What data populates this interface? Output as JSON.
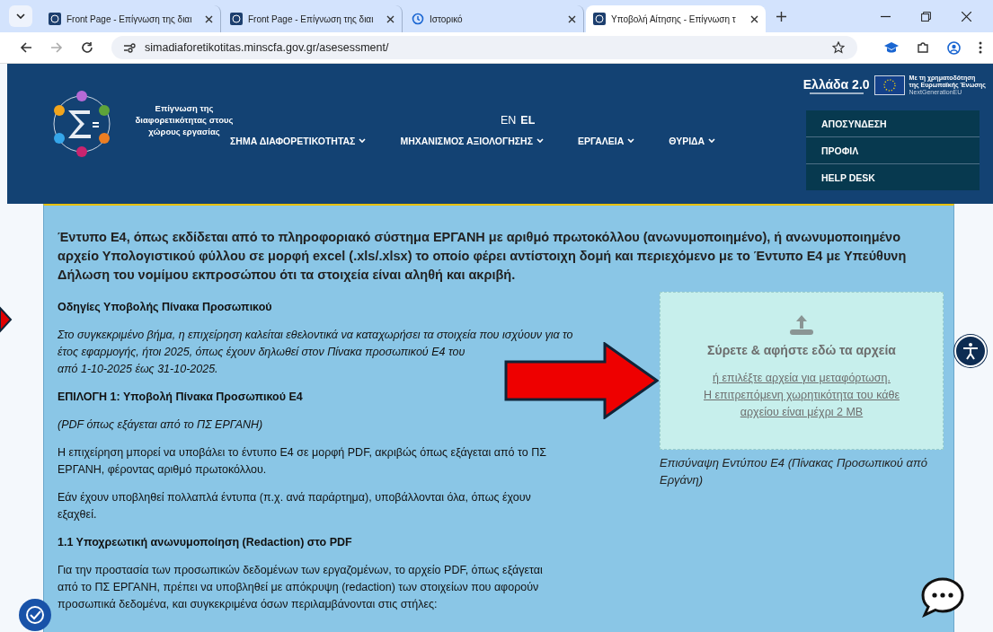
{
  "browser": {
    "tabs": [
      {
        "title": "Front Page - Επίγνωση της διαι",
        "kind": "page",
        "selected": false
      },
      {
        "title": "Front Page - Επίγνωση της διαι",
        "kind": "page",
        "selected": false
      },
      {
        "title": "Ιστορικό",
        "kind": "history",
        "selected": false
      },
      {
        "title": "Υποβολή Αίτησης - Επίγνωση τ",
        "kind": "page",
        "selected": true
      }
    ],
    "url": "simadiaforetikotitas.minscfa.gov.gr/asesessment/"
  },
  "header": {
    "logo_text": "Επίγνωση της διαφορετικότητας στους χώρους εργασίας",
    "languages": [
      {
        "label": "EN",
        "selected": false
      },
      {
        "label": "EL",
        "selected": true
      }
    ],
    "nav": [
      {
        "label": "ΣΗΜΑ ΔΙΑΦΟΡΕΤΙΚΟΤΗΤΑΣ"
      },
      {
        "label": "ΜΗΧΑΝΙΣΜΟΣ ΑΞΙΟΛΟΓΗΣΗΣ"
      },
      {
        "label": "ΕΡΓΑΛΕΙΑ"
      },
      {
        "label": "ΘΥΡΙΔΑ"
      }
    ],
    "greece_logo": "Ελλάδα 2.0",
    "eu_text": [
      "Με τη χρηματοδότηση",
      "της Ευρωπαϊκής Ένωσης",
      "NextGenerationEU"
    ],
    "account_menu": [
      "ΑΠΟΣΥΝΔΕΣΗ",
      "ΠΡΟΦΙΛ",
      "HELP DESK"
    ]
  },
  "content": {
    "intro": "Έντυπο Ε4, όπως εκδίδεται από το πληροφοριακό σύστημα ΕΡΓΑΝΗ με αριθμό πρωτοκόλλου (ανωνυμοποιημένο), ή ανωνυμοποιημένο αρχείο Υπολογιστικού φύλλου σε μορφή excel (.xls/.xlsx)  το οποίο φέρει αντίστοιχη δομή και περιεχόμενο με το Έντυπο Ε4 με Υπεύθυνη Δήλωση του νομίμου εκπροσώπου ότι τα στοιχεία είναι αληθή και ακριβή.",
    "blocks": [
      {
        "kind": "heading",
        "lines": [
          "Οδηγίες Υποβολής Πίνακα Προσωπικού"
        ]
      },
      {
        "kind": "italic",
        "lines": [
          "Στο συγκεκριμένο βήμα, η επιχείρηση καλείται εθελοντικά να καταχωρήσει τα στοιχεία που ισχύουν για το",
          "έτος εφαρμογής, ήτοι 2025, όπως έχουν δηλωθεί στον Πίνακα προσωπικού Ε4 του",
          "από 1-10-2025 έως 31-10-2025."
        ]
      },
      {
        "kind": "heading",
        "lines": [
          "ΕΠΙΛΟΓΗ 1: Υποβολή Πίνακα Προσωπικού Ε4"
        ]
      },
      {
        "kind": "italic",
        "lines": [
          "(PDF όπως εξάγεται από το ΠΣ ΕΡΓΑΝΗ)"
        ]
      },
      {
        "kind": "paragraph",
        "lines": [
          "Η επιχείρηση μπορεί να υποβάλει το έντυπο Ε4 σε μορφή PDF, ακριβώς όπως εξάγεται από το ΠΣ",
          "ΕΡΓΑΝΗ, φέροντας αριθμό πρωτοκόλλου."
        ]
      },
      {
        "kind": "paragraph",
        "lines": [
          "Εάν έχουν υποβληθεί πολλαπλά έντυπα (π.χ. ανά παράρτημα), υποβάλλονται όλα, όπως έχουν",
          "εξαχθεί."
        ]
      },
      {
        "kind": "heading",
        "lines": [
          "1.1 Υποχρεωτική ανωνυμοποίηση (Redaction) στο PDF"
        ]
      },
      {
        "kind": "paragraph",
        "lines": [
          "Για την προστασία των προσωπικών δεδομένων των εργαζομένων, το αρχείο PDF, όπως εξάγεται",
          "από το ΠΣ ΕΡΓΑΝΗ, πρέπει να υποβληθεί με απόκρυψη (redaction) των στοιχείων που αφορούν",
          "προσωπικά δεδομένα, και συγκεκριμένα όσων περιλαμβάνονται στις στήλες:"
        ]
      }
    ],
    "upload": {
      "title": "Σύρετε & αφήστε εδώ τα αρχεία",
      "link_lines": [
        "ή επιλέξτε αρχεία για μεταφόρτωση.",
        "Η επιτρεπόμενη χωρητικότητα του κάθε",
        "αρχείου είναι μέχρι 2 MB"
      ],
      "caption": "Επισύναψη Εντύπου Ε4 (Πίνακας Προσωπικού από Εργάνη)"
    }
  }
}
